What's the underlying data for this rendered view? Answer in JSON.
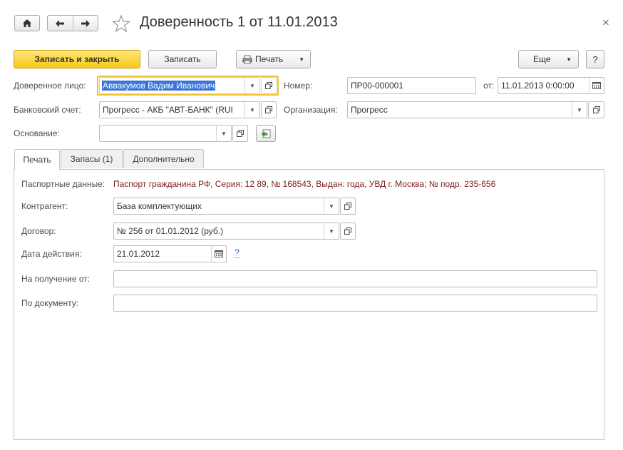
{
  "window": {
    "title": "Доверенность 1 от 11.01.2013",
    "close_icon": "×"
  },
  "toolbar": {
    "save_close_label": "Записать и закрыть",
    "save_label": "Записать",
    "print_label": "Печать",
    "more_label": "Еще",
    "help_label": "?"
  },
  "header": {
    "trustee_label": "Доверенное лицо:",
    "trustee_value": "Аввакумов Вадим Иванович",
    "number_label": "Номер:",
    "number_value": "ПР00-000001",
    "date_label": "от:",
    "date_value": "11.01.2013  0:00:00",
    "bank_label": "Банковский счет:",
    "bank_value": "Прогресс - АКБ \"АВТ-БАНК\" (RUI",
    "org_label": "Организация:",
    "org_value": "Прогресс",
    "basis_label": "Основание:",
    "basis_value": ""
  },
  "tabs": [
    {
      "label": "Печать",
      "active": true
    },
    {
      "label": "Запасы (1)",
      "active": false
    },
    {
      "label": "Дополнительно",
      "active": false
    }
  ],
  "print_tab": {
    "passport_label": "Паспортные данные:",
    "passport_value": "Паспорт гражданина РФ,  Серия: 12 89, № 168543, Выдан:  года, УВД г. Москва; № подр. 235-656",
    "counterparty_label": "Контрагент:",
    "counterparty_value": "База комплектующих",
    "contract_label": "Договор:",
    "contract_value": "№ 256 от 01.01.2012 (руб.)",
    "valid_date_label": "Дата действия:",
    "valid_date_value": "21.01.2012",
    "valid_date_help": "?",
    "receive_from_label": "На получение от:",
    "receive_from_value": "",
    "by_document_label": "По документу:",
    "by_document_value": ""
  },
  "colors": {
    "accent": "#f5c918",
    "focus_border": "#f1c232",
    "selection": "#3875d7",
    "passport_text": "#7b1e1e",
    "help_link": "#2a6bb8"
  }
}
